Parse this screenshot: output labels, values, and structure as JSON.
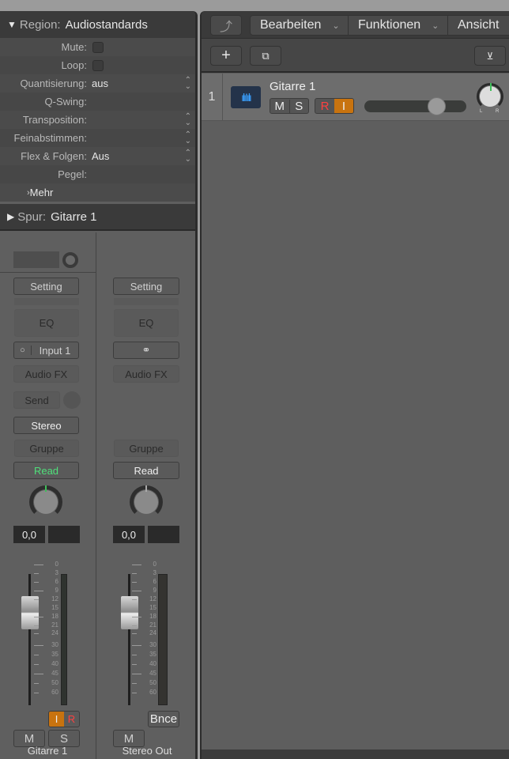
{
  "inspector": {
    "region_label": "Region:",
    "region_name": "Audiostandards",
    "rows": [
      {
        "label": "Mute:"
      },
      {
        "label": "Loop:"
      },
      {
        "label": "Quantisierung:",
        "value": "aus"
      },
      {
        "label": "Q-Swing:"
      },
      {
        "label": "Transposition:"
      },
      {
        "label": "Feinabstimmen:"
      },
      {
        "label": "Flex & Folgen:",
        "value": "Aus"
      },
      {
        "label": "Pegel:"
      }
    ],
    "more": "Mehr",
    "track_label": "Spur:",
    "track_name": "Gitarre 1"
  },
  "strips": [
    {
      "setting": "Setting",
      "eq": "EQ",
      "input": "Input 1",
      "audio_fx": "Audio FX",
      "send": "Send",
      "output": "Stereo",
      "group": "Gruppe",
      "automation": "Read",
      "volume": "0,0",
      "input_btn": "I",
      "record_btn": "R",
      "mute": "M",
      "solo": "S",
      "name": "Gitarre 1"
    },
    {
      "setting": "Setting",
      "eq": "EQ",
      "audio_fx": "Audio FX",
      "group": "Gruppe",
      "automation": "Read",
      "volume": "0,0",
      "bounce": "Bnce",
      "mute": "M",
      "name": "Stereo Out"
    }
  ],
  "meter_scale": [
    "0",
    "3",
    "6",
    "9",
    "12",
    "15",
    "18",
    "21",
    "24",
    "30",
    "35",
    "40",
    "45",
    "50",
    "60"
  ],
  "toolbar": {
    "edit": "Bearbeiten",
    "functions": "Funktionen",
    "view": "Ansicht"
  },
  "track": {
    "number": "1",
    "name": "Gitarre 1",
    "mute": "M",
    "solo": "S",
    "record": "R",
    "input": "I",
    "pan_left": "L",
    "pan_right": "R",
    "volume_fraction": 0.75
  },
  "colors": {
    "read_active": "#4fe07a",
    "record": "#ff4040",
    "input_active": "#c8730f",
    "region_icon": "#3aa0ff"
  }
}
